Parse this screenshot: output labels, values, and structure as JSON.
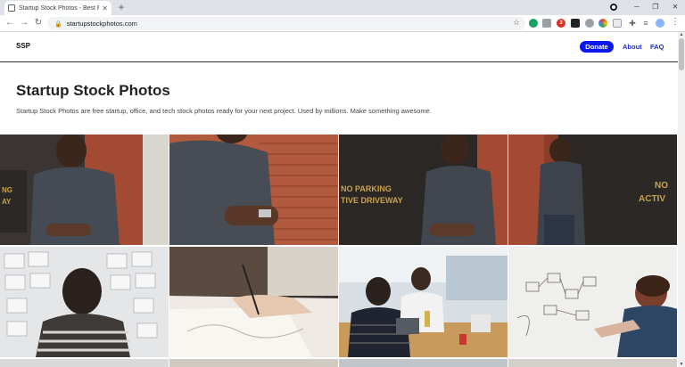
{
  "browser": {
    "tab_title": "Startup Stock Photos - Best Free",
    "url": "startupstockphotos.com",
    "ext_badge_count": "3"
  },
  "site": {
    "logo": "SSP",
    "nav": {
      "donate": "Donate",
      "about": "About",
      "faq": "FAQ"
    },
    "hero": {
      "title": "Startup Stock Photos",
      "description": "Startup Stock Photos are free startup, office, and tech stock photos ready for your next project. Used by millions. Make something awesome."
    }
  },
  "photos": [
    {
      "scene": "man-phone-brick-wall"
    },
    {
      "scene": "man-phone-closeup"
    },
    {
      "scene": "man-phone-no-parking"
    },
    {
      "scene": "man-leaning-no-parking"
    },
    {
      "scene": "man-wall-of-sketches",
      "wall_text": "NO PARKING ACTIVE DRIVEWAY"
    },
    {
      "scene": "hand-sketching"
    },
    {
      "scene": "people-laptops-cafe"
    },
    {
      "scene": "man-whiteboard"
    }
  ],
  "photo_text": {
    "p1": "NG",
    "p1b": "AY",
    "p3a": "NO PARKING",
    "p3b": "TIVE DRIVEWAY",
    "p4a": "NO",
    "p4b": "ACTIV"
  },
  "colors": {
    "accent": "#0a18f0",
    "nav_link": "#1a2bd6"
  }
}
